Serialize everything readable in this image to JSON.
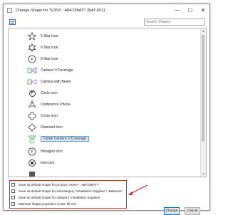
{
  "window": {
    "title": "Change Shape for 'SONY - ABF238ATT (BAT-001)'",
    "minimize_glyph": "—",
    "maximize_glyph": "☐",
    "close_glyph": "✕"
  },
  "toolbar": {
    "view_icon": "grid-view-icon",
    "search_placeholder": "Search Shapes"
  },
  "shapes": [
    {
      "label": "5-Star Icon",
      "icon": "star-icon"
    },
    {
      "label": "6-Star Icon",
      "icon": "star-icon"
    },
    {
      "label": "8-Star Icon",
      "icon": "star-circle-icon"
    },
    {
      "label": "Camera 'n'Coverage",
      "icon": "camera-coverage-icon"
    },
    {
      "label": "Camera with Beam",
      "icon": "camera-beam-icon"
    },
    {
      "label": "Circle Icon",
      "icon": "circle-p-icon",
      "glyph": "P"
    },
    {
      "label": "Conference Phone",
      "icon": "conference-phone-icon"
    },
    {
      "label": "Cross Icon",
      "icon": "cross-icon"
    },
    {
      "label": "Diamond Icon",
      "icon": "diamond-icon"
    },
    {
      "label": "Dome Camera 'n'Coverage",
      "icon": "dome-camera-icon",
      "selected": true
    },
    {
      "label": "Hexagon Icon",
      "icon": "hexagon-icon",
      "glyph": "P"
    },
    {
      "label": "Intercom",
      "icon": "intercom-icon"
    }
  ],
  "options": [
    {
      "label": "Save as default shape for product 'SONY - ABF238ATT'",
      "checked": false
    },
    {
      "label": "Save as default shape for subcategory 'Installation Supplies > Batteries'",
      "checked": false
    },
    {
      "label": "Save as default shape for category 'Installation Supplies'",
      "checked": false
    },
    {
      "label": "Maintain shape properties (color, fill etc)",
      "checked": false
    }
  ],
  "buttons": {
    "change": "Change",
    "cancel": "Cancel"
  },
  "colors": {
    "highlight": "#d6261f",
    "selection_border": "#5c9bd6",
    "selection_fill": "#dbeaf8",
    "accent_green": "#2e9e4a",
    "accent_purple": "#8a3fc1"
  }
}
